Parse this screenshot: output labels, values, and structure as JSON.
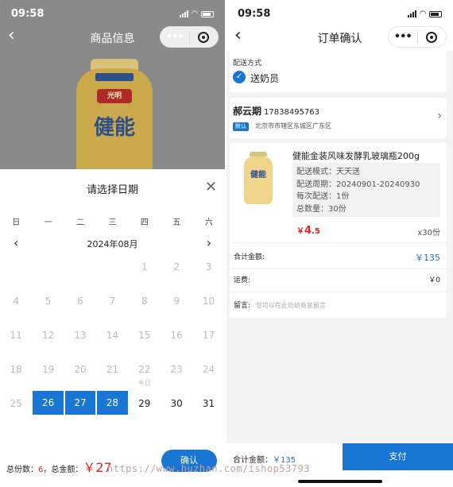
{
  "left": {
    "status": {
      "time": "09:58"
    },
    "nav": {
      "title": "商品信息"
    },
    "product_image": {
      "logo": "光明",
      "brand": "健能"
    },
    "sheet": {
      "title": "请选择日期",
      "weekdays": [
        "日",
        "一",
        "二",
        "三",
        "四",
        "五",
        "六"
      ],
      "month": "2024年08月",
      "rows": [
        [
          {
            "d": ""
          },
          {
            "d": ""
          },
          {
            "d": ""
          },
          {
            "d": ""
          },
          {
            "d": "1"
          },
          {
            "d": "2"
          },
          {
            "d": "3"
          }
        ],
        [
          {
            "d": "4"
          },
          {
            "d": "5"
          },
          {
            "d": "6"
          },
          {
            "d": "7"
          },
          {
            "d": "8"
          },
          {
            "d": "9"
          },
          {
            "d": "10"
          }
        ],
        [
          {
            "d": "11"
          },
          {
            "d": "12"
          },
          {
            "d": "13"
          },
          {
            "d": "14"
          },
          {
            "d": "15"
          },
          {
            "d": "16"
          },
          {
            "d": "17"
          }
        ],
        [
          {
            "d": "18"
          },
          {
            "d": "19"
          },
          {
            "d": "20"
          },
          {
            "d": "21"
          },
          {
            "d": "22",
            "sub": "今日"
          },
          {
            "d": "23"
          },
          {
            "d": "24"
          }
        ],
        [
          {
            "d": "25"
          },
          {
            "d": "26",
            "sel": true
          },
          {
            "d": "27",
            "sel": true
          },
          {
            "d": "28",
            "sel": true
          },
          {
            "d": "29",
            "active": true
          },
          {
            "d": "30",
            "active": true
          },
          {
            "d": "31",
            "active": true
          }
        ]
      ]
    },
    "summary": {
      "count_label": "总份数：",
      "count": "6",
      "sep": "，总金额：",
      "amount": "￥27"
    },
    "confirm_label": "确认"
  },
  "right": {
    "status": {
      "time": "09:58"
    },
    "nav": {
      "title": "订单确认"
    },
    "delivery": {
      "label": "配送方式",
      "option": "送奶员"
    },
    "address": {
      "name": "郝云期",
      "phone": "17838495763",
      "tag": "默认",
      "text": "北京市市辖区东城区广东区"
    },
    "item": {
      "name": "健能金装风味发酵乳玻璃瓶200g",
      "image_text": "健能",
      "spec": [
        "配送模式：天天送",
        "配送周期：20240901-20240930",
        "每次配送：1份",
        "总数量：30份"
      ],
      "price_symbol": "￥",
      "price_int": "4",
      "price_dec": ".5",
      "qty": "x30份"
    },
    "total": {
      "label": "合计金额:",
      "value": "￥135"
    },
    "shipping": {
      "label": "运费:",
      "value": "￥0"
    },
    "remark": {
      "label": "留言:",
      "placeholder": "您可以在此处给商家留言"
    },
    "footer": {
      "label": "合计金额：",
      "amount": "￥135",
      "pay": "支付"
    }
  },
  "watermark": "https://www.huzhan.com/ishop53793"
}
